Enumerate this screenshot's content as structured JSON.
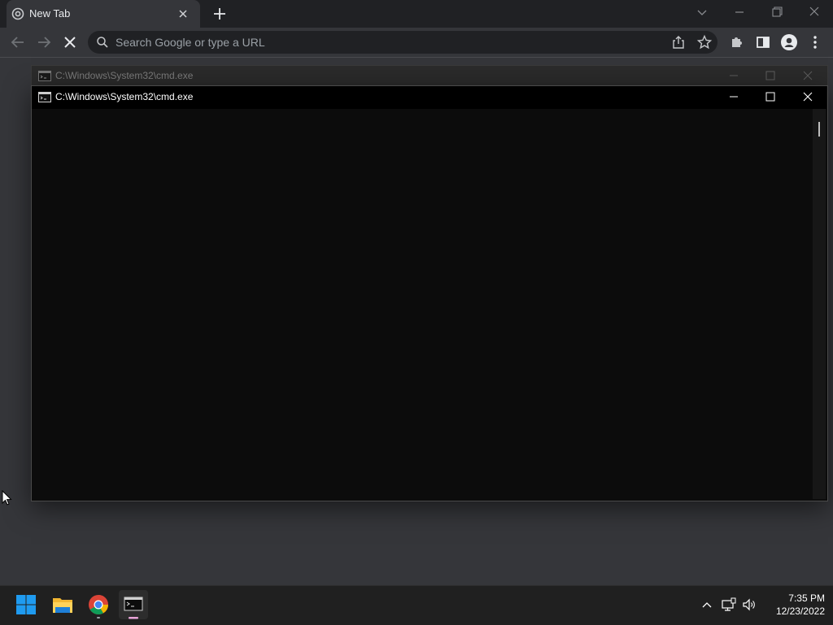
{
  "browser": {
    "tab_title": "New Tab",
    "omnibox_placeholder": "Search Google or type a URL"
  },
  "cmd_windows": {
    "back_title": "C:\\Windows\\System32\\cmd.exe",
    "front_title": "C:\\Windows\\System32\\cmd.exe"
  },
  "taskbar": {
    "apps": [
      "start",
      "file-explorer",
      "chrome",
      "command-prompt"
    ],
    "time": "7:35 PM",
    "date": "12/23/2022"
  },
  "colors": {
    "chrome_frame": "#202124",
    "chrome_toolbar": "#35363a",
    "cmd_background": "#0c0c0c",
    "taskbar": "#202020",
    "windows_blue": "#0a84ff"
  }
}
